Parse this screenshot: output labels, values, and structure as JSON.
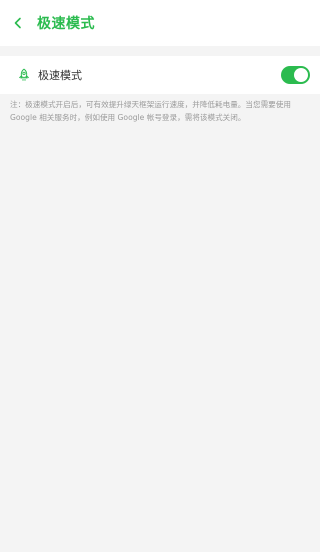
{
  "header": {
    "back_icon": "chevron-left-icon",
    "title": "极速模式"
  },
  "setting": {
    "icon": "rocket-icon",
    "label": "极速模式",
    "toggle_on": true
  },
  "note": "注：极速模式开启后，可有效提升绿天框架运行速度，并降低耗电量。当您需要使用 Google 相关服务时，例如使用 Google 帐号登录，需将该模式关闭。",
  "colors": {
    "accent": "#2bbb4f",
    "background": "#f4f4f4",
    "surface": "#ffffff",
    "note_text": "#9a9a9a"
  }
}
